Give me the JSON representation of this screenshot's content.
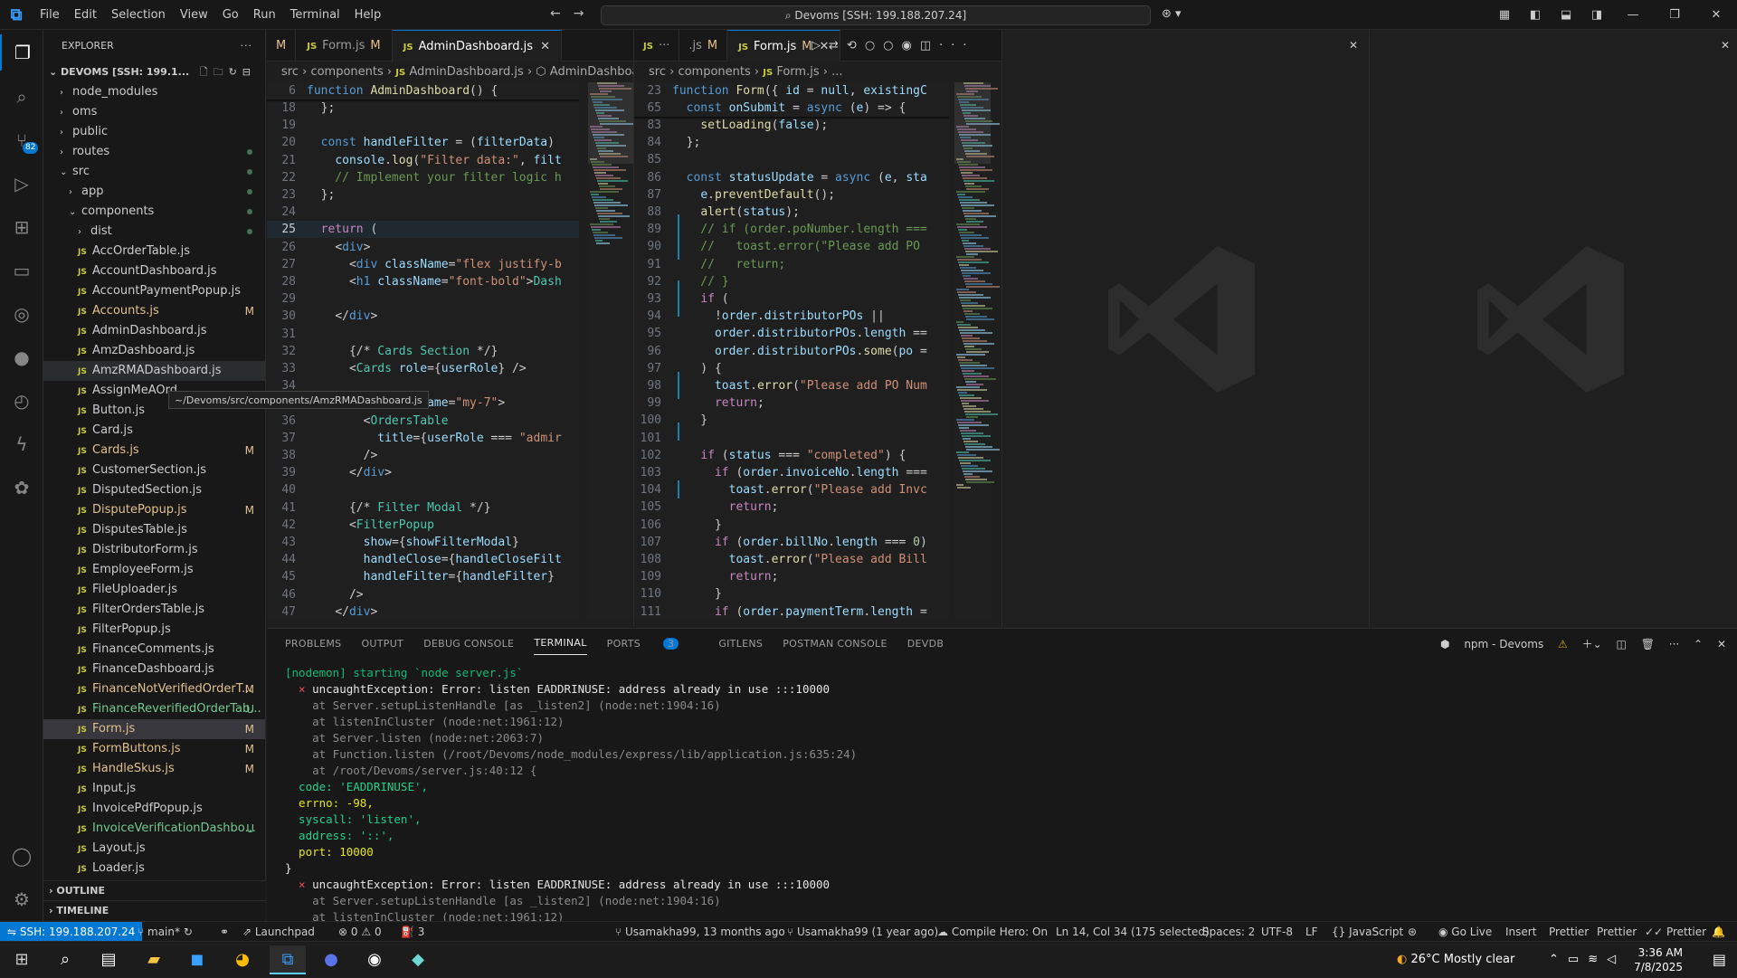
{
  "titlebar": {
    "menu": [
      "File",
      "Edit",
      "Selection",
      "View",
      "Go",
      "Run",
      "Terminal",
      "Help"
    ],
    "command_center": "Devoms [SSH: 199.188.207.24]"
  },
  "explorer": {
    "title": "EXPLORER",
    "root": "DEVOMS [SSH: 199.1...",
    "tooltip": "~/Devoms/src/components/AmzRMADashboard.js",
    "items": [
      {
        "label": "node_modules",
        "type": "folder",
        "indent": 0,
        "status": ""
      },
      {
        "label": "oms",
        "type": "folder",
        "indent": 0,
        "status": ""
      },
      {
        "label": "public",
        "type": "folder",
        "indent": 0,
        "status": ""
      },
      {
        "label": "routes",
        "type": "folder",
        "indent": 0,
        "status": "dot"
      },
      {
        "label": "src",
        "type": "folder-open",
        "indent": 0,
        "status": "dot"
      },
      {
        "label": "app",
        "type": "folder",
        "indent": 1,
        "status": "dot"
      },
      {
        "label": "components",
        "type": "folder-open",
        "indent": 1,
        "status": "dot"
      },
      {
        "label": "dist",
        "type": "folder",
        "indent": 2,
        "status": "dot"
      },
      {
        "label": "AccOrderTable.js",
        "type": "js",
        "indent": 2,
        "status": ""
      },
      {
        "label": "AccountDashboard.js",
        "type": "js",
        "indent": 2,
        "status": ""
      },
      {
        "label": "AccountPaymentPopup.js",
        "type": "js",
        "indent": 2,
        "status": ""
      },
      {
        "label": "Accounts.js",
        "type": "js",
        "indent": 2,
        "status": "M"
      },
      {
        "label": "AdminDashboard.js",
        "type": "js",
        "indent": 2,
        "status": ""
      },
      {
        "label": "AmzDashboard.js",
        "type": "js",
        "indent": 2,
        "status": ""
      },
      {
        "label": "AmzRMADashboard.js",
        "type": "js",
        "indent": 2,
        "status": "",
        "hover": true
      },
      {
        "label": "AssignMeAOrd",
        "type": "js",
        "indent": 2,
        "status": ""
      },
      {
        "label": "Button.js",
        "type": "js",
        "indent": 2,
        "status": ""
      },
      {
        "label": "Card.js",
        "type": "js",
        "indent": 2,
        "status": ""
      },
      {
        "label": "Cards.js",
        "type": "js",
        "indent": 2,
        "status": "M"
      },
      {
        "label": "CustomerSection.js",
        "type": "js",
        "indent": 2,
        "status": ""
      },
      {
        "label": "DisputedSection.js",
        "type": "js",
        "indent": 2,
        "status": ""
      },
      {
        "label": "DisputePopup.js",
        "type": "js",
        "indent": 2,
        "status": "M"
      },
      {
        "label": "DisputesTable.js",
        "type": "js",
        "indent": 2,
        "status": ""
      },
      {
        "label": "DistributorForm.js",
        "type": "js",
        "indent": 2,
        "status": ""
      },
      {
        "label": "EmployeeForm.js",
        "type": "js",
        "indent": 2,
        "status": ""
      },
      {
        "label": "FileUploader.js",
        "type": "js",
        "indent": 2,
        "status": ""
      },
      {
        "label": "FilterOrdersTable.js",
        "type": "js",
        "indent": 2,
        "status": ""
      },
      {
        "label": "FilterPopup.js",
        "type": "js",
        "indent": 2,
        "status": ""
      },
      {
        "label": "FinanceComments.js",
        "type": "js",
        "indent": 2,
        "status": ""
      },
      {
        "label": "FinanceDashboard.js",
        "type": "js",
        "indent": 2,
        "status": ""
      },
      {
        "label": "FinanceNotVerifiedOrderT...",
        "type": "js",
        "indent": 2,
        "status": "M"
      },
      {
        "label": "FinanceReverifiedOrderTab...",
        "type": "js",
        "indent": 2,
        "status": "U"
      },
      {
        "label": "Form.js",
        "type": "js",
        "indent": 2,
        "status": "M",
        "selected": true
      },
      {
        "label": "FormButtons.js",
        "type": "js",
        "indent": 2,
        "status": "M"
      },
      {
        "label": "HandleSkus.js",
        "type": "js",
        "indent": 2,
        "status": "M"
      },
      {
        "label": "Input.js",
        "type": "js",
        "indent": 2,
        "status": ""
      },
      {
        "label": "InvoicePdfPopup.js",
        "type": "js",
        "indent": 2,
        "status": ""
      },
      {
        "label": "InvoiceVerificationDashbo...",
        "type": "js",
        "indent": 2,
        "status": "U"
      },
      {
        "label": "Layout.js",
        "type": "js",
        "indent": 2,
        "status": ""
      },
      {
        "label": "Loader.js",
        "type": "js",
        "indent": 2,
        "status": ""
      }
    ],
    "outline": "OUTLINE",
    "timeline": "TIMELINE"
  },
  "left_editor": {
    "tabs": [
      {
        "label": "M",
        "js": false,
        "modified": "",
        "partial": true
      },
      {
        "label": "Form.js",
        "js": true,
        "modified": "M"
      },
      {
        "label": "AdminDashboard.js",
        "js": true,
        "modified": "",
        "close": true,
        "active": true
      }
    ],
    "breadcrumb": [
      "src",
      "components",
      "AdminDashboard.js",
      "AdminDashboard"
    ],
    "sticky": {
      "num": "6",
      "code": "function AdminDashboard() {"
    },
    "lines": [
      {
        "n": "18",
        "t": "  };"
      },
      {
        "n": "19",
        "t": ""
      },
      {
        "n": "20",
        "t": "  const handleFilter = (filterData) "
      },
      {
        "n": "21",
        "t": "    console.log(\"Filter data:\", filt"
      },
      {
        "n": "22",
        "t": "    // Implement your filter logic h"
      },
      {
        "n": "23",
        "t": "  };"
      },
      {
        "n": "24",
        "t": ""
      },
      {
        "n": "25",
        "t": "  return ("
      },
      {
        "n": "26",
        "t": "    <div>"
      },
      {
        "n": "27",
        "t": "      <div className=\"flex justify-b"
      },
      {
        "n": "28",
        "t": "      <h1 className=\"font-bold\">Dash"
      },
      {
        "n": "29",
        "t": ""
      },
      {
        "n": "30",
        "t": "    </div>"
      },
      {
        "n": "31",
        "t": ""
      },
      {
        "n": "32",
        "t": "      {/* Cards Section */}"
      },
      {
        "n": "33",
        "t": "      <Cards role={userRole} />"
      },
      {
        "n": "34",
        "t": ""
      },
      {
        "n": "35",
        "t": "      <div className=\"my-7\">"
      },
      {
        "n": "36",
        "t": "        <OrdersTable"
      },
      {
        "n": "37",
        "t": "          title={userRole === \"admir"
      },
      {
        "n": "38",
        "t": "        />"
      },
      {
        "n": "39",
        "t": "      </div>"
      },
      {
        "n": "40",
        "t": ""
      },
      {
        "n": "41",
        "t": "      {/* Filter Modal */}"
      },
      {
        "n": "42",
        "t": "      <FilterPopup"
      },
      {
        "n": "43",
        "t": "        show={showFilterModal}"
      },
      {
        "n": "44",
        "t": "        handleClose={handleCloseFilt"
      },
      {
        "n": "45",
        "t": "        handleFilter={handleFilter}"
      },
      {
        "n": "46",
        "t": "      />"
      },
      {
        "n": "47",
        "t": "    </div>"
      }
    ]
  },
  "right_editor": {
    "tabs": [
      {
        "label": "JS ...",
        "partial": true
      },
      {
        "label": ".js M",
        "partial": true
      },
      {
        "label": "Form.js",
        "js": true,
        "modified": "M",
        "close": true,
        "active": true
      }
    ],
    "breadcrumb": [
      "src",
      "components",
      "Form.js",
      "..."
    ],
    "sticky": [
      {
        "num": "23",
        "code": "function Form({ id = null, existingC"
      },
      {
        "num": "65",
        "code": "  const onSubmit = async (e) => {"
      }
    ],
    "lines": [
      {
        "n": "83",
        "t": "    setLoading(false);"
      },
      {
        "n": "84",
        "t": "  };"
      },
      {
        "n": "85",
        "t": ""
      },
      {
        "n": "86",
        "t": "  const statusUpdate = async (e, sta"
      },
      {
        "n": "87",
        "t": "    e.preventDefault();"
      },
      {
        "n": "88",
        "t": "    alert(status);"
      },
      {
        "n": "89",
        "t": "    // if (order.poNumber.length ==="
      },
      {
        "n": "90",
        "t": "    //   toast.error(\"Please add PO "
      },
      {
        "n": "91",
        "t": "    //   return;"
      },
      {
        "n": "92",
        "t": "    // }"
      },
      {
        "n": "93",
        "t": "    if ("
      },
      {
        "n": "94",
        "t": "      !order.distributorPOs ||"
      },
      {
        "n": "95",
        "t": "      order.distributorPOs.length =="
      },
      {
        "n": "96",
        "t": "      order.distributorPOs.some(po ="
      },
      {
        "n": "97",
        "t": "    ) {"
      },
      {
        "n": "98",
        "t": "      toast.error(\"Please add PO Num"
      },
      {
        "n": "99",
        "t": "      return;"
      },
      {
        "n": "100",
        "t": "    }"
      },
      {
        "n": "101",
        "t": ""
      },
      {
        "n": "102",
        "t": "    if (status === \"completed\") {"
      },
      {
        "n": "103",
        "t": "      if (order.invoiceNo.length ==="
      },
      {
        "n": "104",
        "t": "        toast.error(\"Please add Invc"
      },
      {
        "n": "105",
        "t": "        return;"
      },
      {
        "n": "106",
        "t": "      }"
      },
      {
        "n": "107",
        "t": "      if (order.billNo.length === 0)"
      },
      {
        "n": "108",
        "t": "        toast.error(\"Please add Bill"
      },
      {
        "n": "109",
        "t": "        return;"
      },
      {
        "n": "110",
        "t": "      }"
      },
      {
        "n": "111",
        "t": "      if (order.paymentTerm.length ="
      }
    ]
  },
  "panel": {
    "tabs": [
      "PROBLEMS",
      "OUTPUT",
      "DEBUG CONSOLE",
      "TERMINAL",
      "PORTS",
      "GITLENS",
      "POSTMAN CONSOLE",
      "DEVDB"
    ],
    "active_tab": "TERMINAL",
    "ports_count": "3",
    "terminal_name": "npm - Devoms",
    "terminal_lines": [
      "[nodemon] starting `node server.js`",
      "uncaughtException: Error: listen EADDRINUSE: address already in use :::10000",
      "    at Server.setupListenHandle [as _listen2] (node:net:1904:16)",
      "    at listenInCluster (node:net:1961:12)",
      "    at Server.listen (node:net:2063:7)",
      "    at Function.listen (/root/Devoms/node_modules/express/lib/application.js:635:24)",
      "    at /root/Devoms/server.js:40:12 {",
      "  code: 'EADDRINUSE',",
      "  errno: -98,",
      "  syscall: 'listen',",
      "  address: '::',",
      "  port: 10000",
      "}",
      "uncaughtException: Error: listen EADDRINUSE: address already in use :::10000",
      "    at Server.setupListenHandle [as _listen2] (node:net:1904:16)",
      "    at listenInCluster (node:net:1961:12)"
    ]
  },
  "statusbar": {
    "remote": "SSH: 199.188.207.24",
    "branch": "main*",
    "launchpad": "Launchpad",
    "problems": "0",
    "warnings": "0",
    "ports": "3",
    "blame1": "Usamakha99, 13 months ago",
    "blame2": "Usamakha99 (1 year ago)",
    "compile": "Compile Hero: On",
    "cursor": "Ln 14, Col 34 (175 selected)",
    "spaces": "Spaces: 2",
    "encoding": "UTF-8",
    "eol": "LF",
    "language": "JavaScript",
    "golive": "Go Live",
    "insert": "Insert",
    "prettier1": "Prettier",
    "prettier2": "Prettier",
    "prettier3": "Prettier"
  },
  "taskbar": {
    "weather_temp": "26°C",
    "weather_desc": "Mostly clear",
    "time": "3:36 AM",
    "date": "7/8/2025"
  },
  "colors": {
    "accent": "#0078d4",
    "modified": "#e2c08d",
    "untracked": "#73c991",
    "error": "#f14c4c"
  }
}
